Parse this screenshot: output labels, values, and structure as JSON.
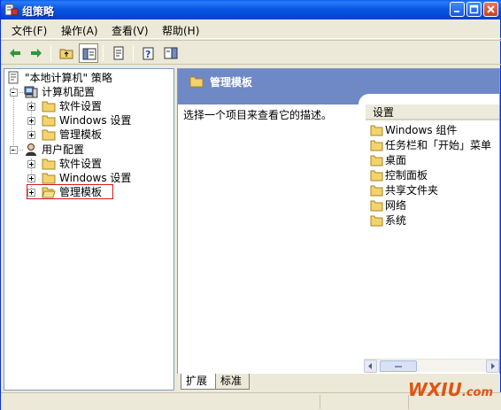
{
  "window": {
    "title": "组策略"
  },
  "menu": {
    "items": [
      "文件(F)",
      "操作(A)",
      "查看(V)",
      "帮助(H)"
    ]
  },
  "tree": {
    "root": "\"本地计算机\" 策略",
    "computer_config": "计算机配置",
    "computer_children": [
      "软件设置",
      "Windows 设置",
      "管理模板"
    ],
    "user_config": "用户配置",
    "user_children": [
      "软件设置",
      "Windows 设置",
      "管理模板"
    ]
  },
  "right_pane": {
    "header_title": "管理模板",
    "description": "选择一个项目来查看它的描述。",
    "list_header": "设置",
    "items": [
      "Windows 组件",
      "任务栏和「开始」菜单",
      "桌面",
      "控制面板",
      "共享文件夹",
      "网络",
      "系统"
    ]
  },
  "tabs": {
    "extended": "扩展",
    "standard": "标准"
  },
  "watermark": {
    "brand": "WXIU",
    "suffix": ".com"
  },
  "colors": {
    "titlebar": "#0b57e3",
    "header_band": "#6f88c6",
    "selection_outline": "#d11b1b",
    "folder": "#f3d36b",
    "watermark": "#e25412"
  }
}
